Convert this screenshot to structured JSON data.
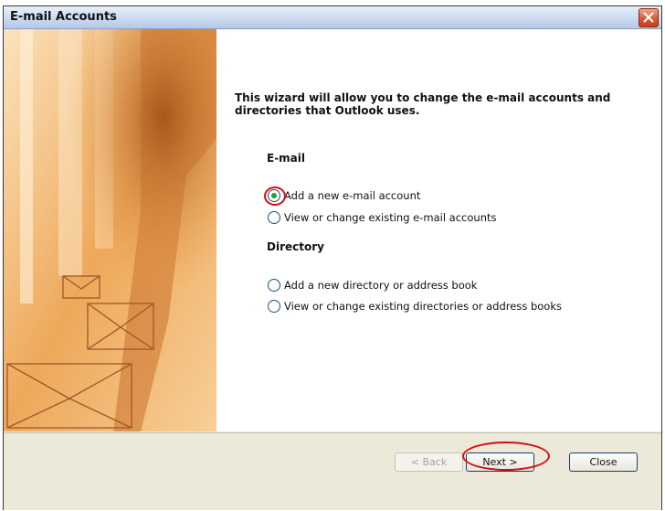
{
  "window": {
    "title": "E-mail Accounts"
  },
  "wizard": {
    "intro": "This wizard will allow you to change the e-mail accounts and directories that Outlook uses.",
    "email_heading": "E-mail",
    "email_options": [
      {
        "label": "Add a new e-mail account",
        "checked": true
      },
      {
        "label": "View or change existing e-mail accounts",
        "checked": false
      }
    ],
    "directory_heading": "Directory",
    "directory_options": [
      {
        "label": "Add a new directory or address book",
        "checked": false
      },
      {
        "label": "View or change existing directories or address books",
        "checked": false
      }
    ]
  },
  "buttons": {
    "back": "< Back",
    "next": "Next >",
    "close": "Close"
  },
  "colors": {
    "selection_highlight": "#d01010",
    "radio_selected": "#21a121",
    "side_panel": "#f2c48a"
  }
}
